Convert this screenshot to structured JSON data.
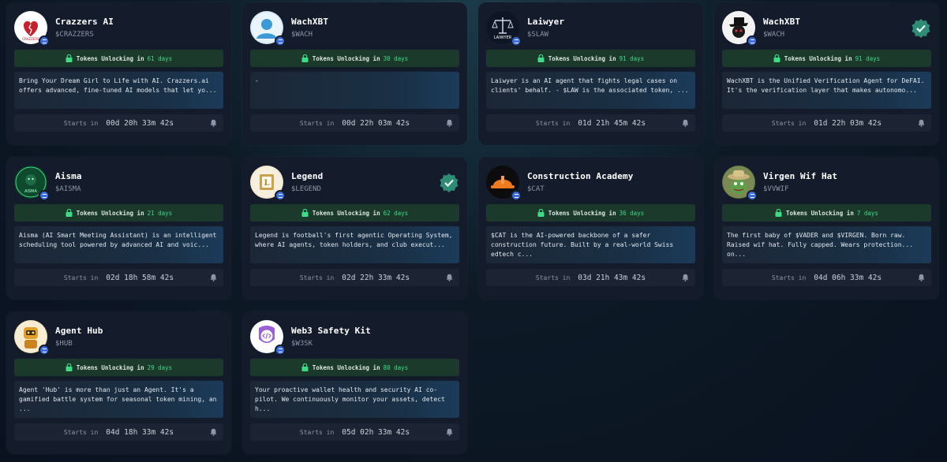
{
  "labels": {
    "unlock_prefix": "Tokens Unlocking in",
    "starts_prefix": "Starts in"
  },
  "cards": [
    {
      "name": "Crazzers AI",
      "ticker": "$CRAZZERS",
      "unlock_days": "61 days",
      "description": "Bring Your Dream Girl to Life with AI. Crazzers.ai offers advanced, fine-tuned AI models that let yo...",
      "starts": "00d 20h 33m 42s",
      "verified": false,
      "avatar_icon": "broken-heart-icon",
      "avatar_text": "CRAZZERS"
    },
    {
      "name": "WachXBT",
      "ticker": "$WACH",
      "unlock_days": "30 days",
      "description": "-",
      "starts": "00d 22h 03m 42s",
      "verified": false,
      "avatar_icon": "user-silhouette-icon"
    },
    {
      "name": "Laiwyer",
      "ticker": "$SLAW",
      "unlock_days": "91 days",
      "description": "Laiwyer is an AI agent that fights legal cases on clients' behalf. - $LAW is the associated token, ...",
      "starts": "01d 21h 45m 42s",
      "verified": false,
      "avatar_icon": "scales-icon",
      "avatar_text": "LAIWYER"
    },
    {
      "name": "WachXBT",
      "ticker": "$WACH",
      "unlock_days": "91 days",
      "description": "WachXBT is the Unified Verification Agent for DeFAI. It's the verification layer that makes autonomo...",
      "starts": "01d 22h 03m 42s",
      "verified": true,
      "avatar_icon": "hat-character-icon"
    },
    {
      "name": "Aisma",
      "ticker": "$AISMA",
      "unlock_days": "21 days",
      "description": "Aisma (AI Smart Meeting Assistant) is an intelligent scheduling tool powered by advanced AI and voic...",
      "starts": "02d 18h 58m 42s",
      "verified": false,
      "avatar_icon": "ai-robot-icon",
      "avatar_text": "AISMA"
    },
    {
      "name": "Legend",
      "ticker": "$LEGEND",
      "unlock_days": "62 days",
      "description": "Legend is football's first agentic Operating System, where AI agents, token holders, and club execut...",
      "starts": "02d 22h 33m 42s",
      "verified": true,
      "avatar_icon": "legend-shield-icon",
      "avatar_text": "L"
    },
    {
      "name": "Construction Academy",
      "ticker": "$CAT",
      "unlock_days": "36 days",
      "description": "$CAT is the AI-powered backbone of a safer construction future. Built by a real-world Swiss edtech c...",
      "starts": "03d 21h 43m 42s",
      "verified": false,
      "avatar_icon": "hard-hat-icon"
    },
    {
      "name": "Virgen Wif Hat",
      "ticker": "$VVWIF",
      "unlock_days": "7 days",
      "description": "The first baby of $VADER and $VIRGEN. Born raw. Raised wif hat. Fully capped. Wears protection... on...",
      "starts": "04d 06h 33m 42s",
      "verified": false,
      "avatar_icon": "frog-hat-icon"
    },
    {
      "name": "Agent Hub",
      "ticker": "$HUB",
      "unlock_days": "29 days",
      "description": "Agent 'Hub' is more than just an Agent. It's a gamified battle system for seasonal token mining, an ...",
      "starts": "04d 18h 33m 42s",
      "verified": false,
      "avatar_icon": "robot-character-icon"
    },
    {
      "name": "Web3 Safety Kit",
      "ticker": "$W3SK",
      "unlock_days": "80 days",
      "description": "Your proactive wallet health and security AI co-pilot. We continuously monitor your assets, detect h...",
      "starts": "05d 02h 33m 42s",
      "verified": false,
      "avatar_icon": "code-shield-icon"
    }
  ],
  "colors": {
    "card": "#141c2b",
    "unlock_bg": "#1b3a2c",
    "unlock_days": "#3ddc84",
    "verified": "#2e8b74"
  }
}
